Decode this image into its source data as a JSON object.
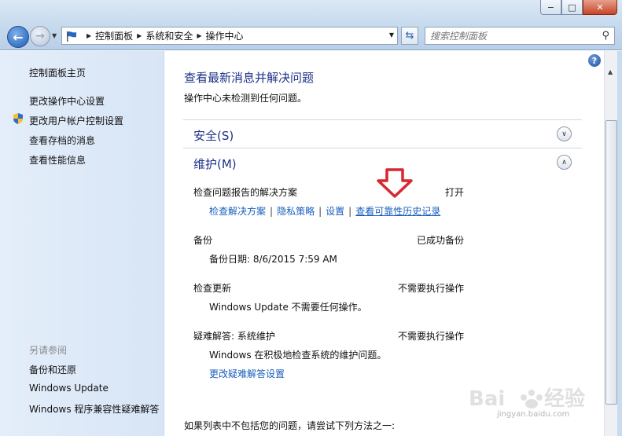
{
  "window": {
    "minimize_glyph": "−",
    "maximize_glyph": "□",
    "close_glyph": "✕"
  },
  "navbar": {
    "breadcrumbs": [
      "控制面板",
      "系统和安全",
      "操作中心"
    ],
    "search_placeholder": "搜索控制面板"
  },
  "sidebar": {
    "home": "控制面板主页",
    "links": [
      "更改操作中心设置",
      "更改用户帐户控制设置",
      "查看存档的消息",
      "查看性能信息"
    ],
    "see_also_header": "另请参阅",
    "see_also": [
      "备份和还原",
      "Windows Update",
      "Windows 程序兼容性疑难解答"
    ]
  },
  "main": {
    "title": "查看最新消息并解决问题",
    "subtitle": "操作中心未检测到任何问题。",
    "security_header": "安全(S)",
    "maintenance_header": "维护(M)",
    "problem_reports": {
      "label": "检查问题报告的解决方案",
      "status": "打开",
      "links": [
        "检查解决方案",
        "隐私策略",
        "设置",
        "查看可靠性历史记录"
      ]
    },
    "backup": {
      "label": "备份",
      "status": "已成功备份",
      "detail": "备份日期: 8/6/2015 7:59 AM"
    },
    "updates": {
      "label": "检查更新",
      "status": "不需要执行操作",
      "detail": "Windows Update 不需要任何操作。"
    },
    "troubleshooting": {
      "label": "疑难解答: 系统维护",
      "status": "不需要执行操作",
      "detail": "Windows 在积极地检查系统的维护问题。",
      "link": "更改疑难解答设置"
    },
    "footer": "如果列表中不包括您的问题，请尝试下列方法之一:"
  },
  "watermark": {
    "url": "jingyan.baidu.com"
  },
  "colors": {
    "heading": "#1e3287",
    "link": "#1a5fbd",
    "arrow": "#d8272e",
    "sidebar_bg": "#dde9f7"
  }
}
